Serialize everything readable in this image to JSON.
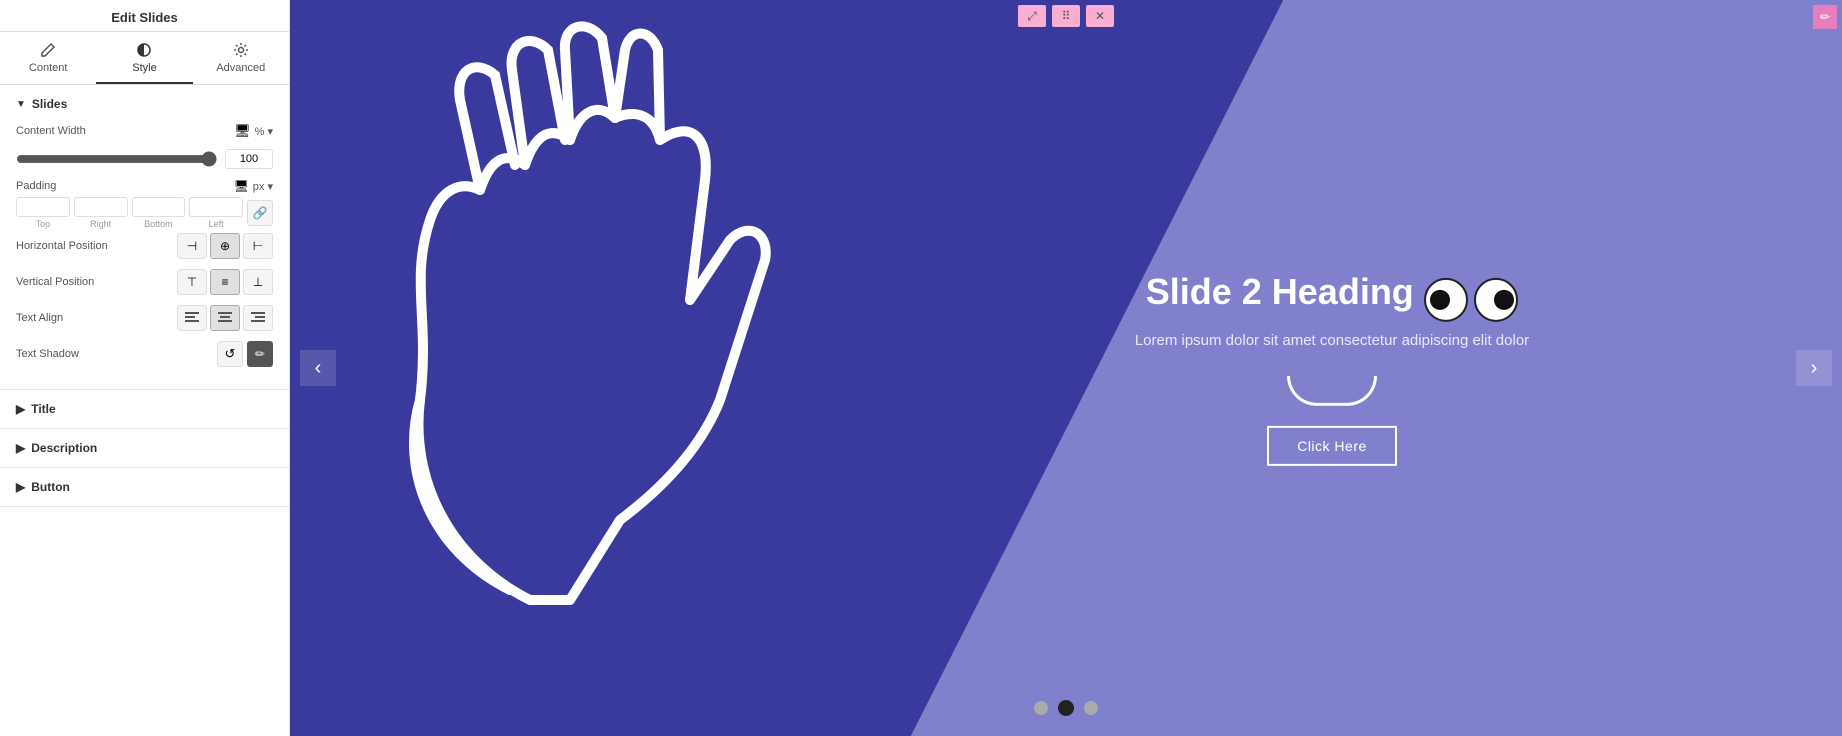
{
  "panel": {
    "header": "Edit Slides",
    "tabs": [
      {
        "id": "content",
        "label": "Content",
        "icon": "pencil"
      },
      {
        "id": "style",
        "label": "Style",
        "icon": "half-circle",
        "active": true
      },
      {
        "id": "advanced",
        "label": "Advanced",
        "icon": "gear"
      }
    ]
  },
  "slides_section": {
    "title": "Slides",
    "content_width": {
      "label": "Content Width",
      "value": "100",
      "unit": "%"
    },
    "padding": {
      "label": "Padding",
      "unit": "px",
      "top": "",
      "right": "",
      "bottom": "",
      "left": "",
      "labels": [
        "Top",
        "Right",
        "Bottom",
        "Left"
      ]
    },
    "horizontal_position": {
      "label": "Horizontal Position",
      "options": [
        "left",
        "center",
        "right"
      ]
    },
    "vertical_position": {
      "label": "Vertical Position",
      "options": [
        "top",
        "middle",
        "bottom"
      ]
    },
    "text_align": {
      "label": "Text Align",
      "options": [
        "left",
        "center",
        "right"
      ]
    },
    "text_shadow": {
      "label": "Text Shadow"
    }
  },
  "collapsible_sections": [
    {
      "id": "title",
      "label": "Title"
    },
    {
      "id": "description",
      "label": "Description"
    },
    {
      "id": "button",
      "label": "Button"
    }
  ],
  "slide": {
    "heading": "Slide 2 Heading",
    "description": "Lorem ipsum dolor sit amet consectetur adipiscing elit dolor",
    "button_label": "Click Here",
    "nav_prev": "‹",
    "nav_next": "›",
    "dots": [
      {
        "active": false
      },
      {
        "active": true
      },
      {
        "active": false
      }
    ]
  },
  "colors": {
    "bg_dark": "#3a3a9e",
    "bg_purple": "#8080cc",
    "panel_bg": "#ffffff",
    "active_tab_border": "#333333",
    "pink_ctrl": "#f9aed2",
    "pink_edit": "#e57fbe"
  }
}
